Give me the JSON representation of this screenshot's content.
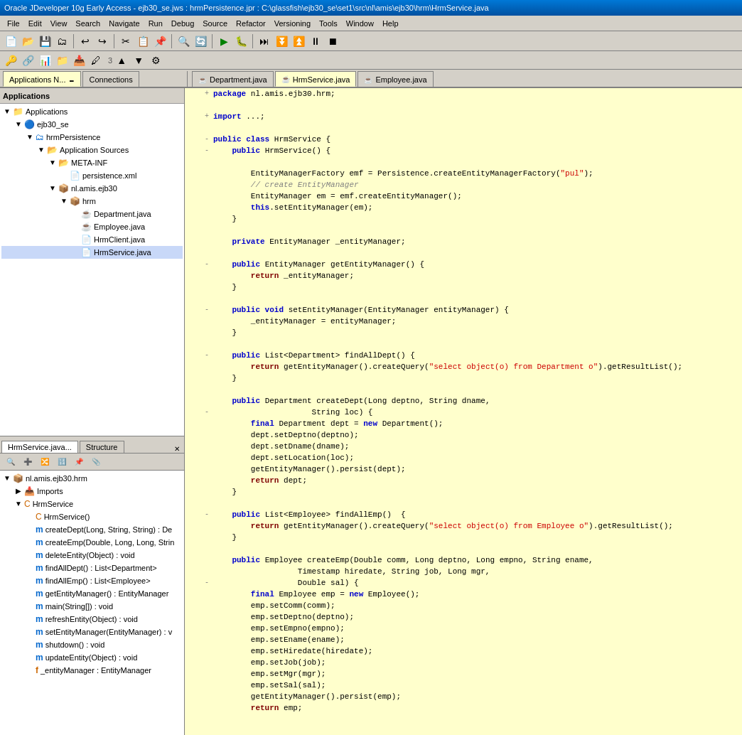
{
  "title_bar": {
    "text": "Oracle JDeveloper 10g Early Access - ejb30_se.jws : hrmPersistence.jpr : C:\\glassfish\\ejb30_se\\set1\\src\\nl\\amis\\ejb30\\hrm\\HrmService.java"
  },
  "menu": {
    "items": [
      "File",
      "Edit",
      "View",
      "Search",
      "Navigate",
      "Run",
      "Debug",
      "Source",
      "Refactor",
      "Versioning",
      "Tools",
      "Window",
      "Help"
    ]
  },
  "tabs": {
    "editors": [
      {
        "label": "Department.java",
        "type": "java",
        "active": false
      },
      {
        "label": "HrmService.java",
        "type": "hrm",
        "active": true
      },
      {
        "label": "Employee.java",
        "type": "java",
        "active": false
      }
    ]
  },
  "left_panel": {
    "panel_tabs": [
      {
        "label": "Applications N...",
        "active": true
      },
      {
        "label": "Connections",
        "active": false
      }
    ],
    "applications_label": "Applications",
    "tree": {
      "items": [
        {
          "label": "Applications",
          "type": "heading",
          "indent": 0
        },
        {
          "label": "ejb30_se",
          "type": "project",
          "indent": 0,
          "expanded": true
        },
        {
          "label": "hrmPersistence",
          "type": "project",
          "indent": 1,
          "expanded": true
        },
        {
          "label": "Application Sources",
          "type": "folder",
          "indent": 2,
          "expanded": true
        },
        {
          "label": "META-INF",
          "type": "folder",
          "indent": 3,
          "expanded": true
        },
        {
          "label": "persistence.xml",
          "type": "xml",
          "indent": 4
        },
        {
          "label": "nl.amis.ejb30",
          "type": "package",
          "indent": 3,
          "expanded": true
        },
        {
          "label": "hrm",
          "type": "package",
          "indent": 4,
          "expanded": true
        },
        {
          "label": "Department.java",
          "type": "java",
          "indent": 5
        },
        {
          "label": "Employee.java",
          "type": "java",
          "indent": 5
        },
        {
          "label": "HrmClient.java",
          "type": "java",
          "indent": 5
        },
        {
          "label": "HrmService.java",
          "type": "java",
          "indent": 5
        }
      ]
    }
  },
  "bottom_left_panel": {
    "tabs": [
      {
        "label": "HrmService.java...",
        "active": true
      },
      {
        "label": "Structure",
        "active": false
      }
    ],
    "tree_items": [
      {
        "label": "nl.amis.ejb30.hrm",
        "type": "package",
        "indent": 0,
        "expanded": true
      },
      {
        "label": "Imports",
        "type": "imports",
        "indent": 1,
        "expanded": false
      },
      {
        "label": "HrmService",
        "type": "class",
        "indent": 1,
        "expanded": true
      },
      {
        "label": "HrmService()",
        "type": "constructor",
        "indent": 2
      },
      {
        "label": "createDept(Long, String, String) : De",
        "type": "method",
        "indent": 2
      },
      {
        "label": "createEmp(Double, Long, Long, Strin",
        "type": "method",
        "indent": 2
      },
      {
        "label": "deleteEntity(Object) : void",
        "type": "method",
        "indent": 2
      },
      {
        "label": "findAllDept() : List<Department>",
        "type": "method",
        "indent": 2
      },
      {
        "label": "findAllEmp() : List<Employee>",
        "type": "method",
        "indent": 2
      },
      {
        "label": "getEntityManager() : EntityManager",
        "type": "method",
        "indent": 2
      },
      {
        "label": "main(String[]) : void",
        "type": "method",
        "indent": 2
      },
      {
        "label": "refreshEntity(Object) : void",
        "type": "method",
        "indent": 2
      },
      {
        "label": "setEntityManager(EntityManager) : v",
        "type": "method",
        "indent": 2
      },
      {
        "label": "shutdown() : void",
        "type": "method",
        "indent": 2
      },
      {
        "label": "updateEntity(Object) : void",
        "type": "method",
        "indent": 2
      },
      {
        "label": "_entityManager : EntityManager",
        "type": "field",
        "indent": 2
      }
    ]
  },
  "code": {
    "package_line": "package nl.amis.ejb30.hrm;",
    "content": [
      {
        "indent": "",
        "fold": "+",
        "text": "package nl.amis.ejb30.hrm;"
      },
      {
        "indent": "",
        "fold": "",
        "text": ""
      },
      {
        "indent": "",
        "fold": "+",
        "text": "import ...;"
      },
      {
        "indent": "",
        "fold": "",
        "text": ""
      },
      {
        "indent": "",
        "fold": "-",
        "kw": "public class ",
        "cls": "HrmService {"
      },
      {
        "indent": "  ",
        "fold": "-",
        "kw": "public ",
        "text": "HrmService() {"
      },
      {
        "indent": "",
        "fold": "",
        "text": ""
      },
      {
        "indent": "    ",
        "fold": "",
        "text": "EntityManagerFactory emf = Persistence.createEntityManagerFactory(\"pul\");"
      },
      {
        "indent": "    ",
        "fold": "",
        "text": "// create EntityManager",
        "cmt": true
      },
      {
        "indent": "    ",
        "fold": "",
        "text": "EntityManager em = emf.createEntityManager();"
      },
      {
        "indent": "    ",
        "fold": "",
        "text": "this.setEntityManager(em);"
      },
      {
        "indent": "  ",
        "fold": "",
        "text": "}"
      },
      {
        "indent": "",
        "fold": "",
        "text": ""
      },
      {
        "indent": "  ",
        "fold": "",
        "kw": "private ",
        "text": "EntityManager _entityManager;"
      },
      {
        "indent": "",
        "fold": "",
        "text": ""
      },
      {
        "indent": "  ",
        "fold": "-",
        "kw": "public ",
        "text": "EntityManager getEntityManager() {"
      },
      {
        "indent": "    ",
        "fold": "",
        "kw2": "return ",
        "text": "_entityManager;"
      },
      {
        "indent": "  ",
        "fold": "",
        "text": "}"
      },
      {
        "indent": "",
        "fold": "",
        "text": ""
      },
      {
        "indent": "  ",
        "fold": "-",
        "kw": "public void ",
        "text": "setEntityManager(EntityManager entityManager) {"
      },
      {
        "indent": "    ",
        "fold": "",
        "text": "_entityManager = entityManager;"
      },
      {
        "indent": "  ",
        "fold": "",
        "text": "}"
      },
      {
        "indent": "",
        "fold": "",
        "text": ""
      },
      {
        "indent": "  ",
        "fold": "-",
        "kw": "public ",
        "text": "List<Department> findAllDept() {"
      },
      {
        "indent": "    ",
        "fold": "",
        "kw2": "return ",
        "str": "getEntityManager().createQuery(\"select object(o) from Department o\").getResultList();"
      },
      {
        "indent": "  ",
        "fold": "",
        "text": "}"
      },
      {
        "indent": "",
        "fold": "",
        "text": ""
      },
      {
        "indent": "  ",
        "fold": "",
        "kw": "public ",
        "text": "Department createDept(Long deptno, String dname,"
      },
      {
        "indent": "  ",
        "fold": "-",
        "text": "                     String loc) {"
      },
      {
        "indent": "    ",
        "fold": "",
        "kw": "final ",
        "text": "Department dept = new Department();"
      },
      {
        "indent": "    ",
        "fold": "",
        "text": "dept.setDeptno(deptno);"
      },
      {
        "indent": "    ",
        "fold": "",
        "text": "dept.setDname(dname);"
      },
      {
        "indent": "    ",
        "fold": "",
        "text": "dept.setLocation(loc);"
      },
      {
        "indent": "    ",
        "fold": "",
        "text": "getEntityManager().persist(dept);"
      },
      {
        "indent": "    ",
        "fold": "",
        "kw2": "return ",
        "text": "dept;"
      },
      {
        "indent": "  ",
        "fold": "",
        "text": "}"
      },
      {
        "indent": "",
        "fold": "",
        "text": ""
      },
      {
        "indent": "  ",
        "fold": "-",
        "kw": "public ",
        "text": "List<Employee> findAllEmp() {"
      },
      {
        "indent": "    ",
        "fold": "",
        "kw2": "return ",
        "str": "getEntityManager().createQuery(\"select object(o) from Employee o\").getResultList();"
      },
      {
        "indent": "  ",
        "fold": "",
        "text": "}"
      },
      {
        "indent": "",
        "fold": "",
        "text": ""
      },
      {
        "indent": "  ",
        "fold": "",
        "kw": "public ",
        "text": "Employee createEmp(Double comm, Long deptno, Long empno, String ename,"
      },
      {
        "indent": "",
        "fold": "",
        "text": "                  Timestamp hiredate, String job, Long mgr,"
      },
      {
        "indent": "  ",
        "fold": "-",
        "text": "                  Double sal) {"
      },
      {
        "indent": "    ",
        "fold": "",
        "kw": "final ",
        "text": "Employee emp = new Employee();"
      },
      {
        "indent": "    ",
        "fold": "",
        "text": "emp.setComm(comm);"
      },
      {
        "indent": "    ",
        "fold": "",
        "text": "emp.setDeptno(deptno);"
      },
      {
        "indent": "    ",
        "fold": "",
        "text": "emp.setEmpno(empno);"
      },
      {
        "indent": "    ",
        "fold": "",
        "text": "emp.setEname(ename);"
      },
      {
        "indent": "    ",
        "fold": "",
        "text": "emp.setHiredate(hiredate);"
      },
      {
        "indent": "    ",
        "fold": "",
        "text": "emp.setJob(job);"
      },
      {
        "indent": "    ",
        "fold": "",
        "text": "emp.setMgr(mgr);"
      },
      {
        "indent": "    ",
        "fold": "",
        "text": "emp.setSal(sal);"
      },
      {
        "indent": "    ",
        "fold": "",
        "text": "getEntityManager().persist(emp);"
      }
    ]
  }
}
